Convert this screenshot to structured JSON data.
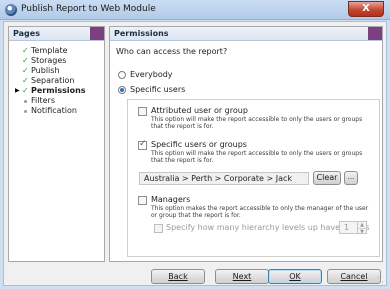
{
  "window": {
    "title": "Publish Report to Web Module",
    "close_label": "X",
    "icon": "publish-icon"
  },
  "pages": {
    "header": "Pages",
    "items": [
      {
        "label": "Template",
        "done": true
      },
      {
        "label": "Storages",
        "done": true
      },
      {
        "label": "Publish",
        "done": true
      },
      {
        "label": "Separation",
        "done": true
      },
      {
        "label": "Permissions",
        "done": true,
        "current": true
      },
      {
        "label": "Filters",
        "done": false
      },
      {
        "label": "Notification",
        "done": false
      }
    ]
  },
  "permissions": {
    "header": "Permissions",
    "question": "Who can access the report?",
    "everybody_label": "Everybody",
    "specific_users_label": "Specific users",
    "selected": "specific_users",
    "attributed": {
      "label": "Attributed user or group",
      "description_1": "This option will make the report accessible to only the users or groups",
      "description_2": "that the report is for.",
      "checked": false
    },
    "specific": {
      "label": "Specific users or groups",
      "description_1": "This option will make the report accessible to only the users or groups",
      "description_2": "that the report is for.",
      "checked": true,
      "path_value": "Australia > Perth > Corporate > Jack",
      "clear_label": "Clear",
      "browse_label": "..."
    },
    "managers": {
      "label": "Managers",
      "description_1": "This option makes the report accessible to only the manager of the user",
      "description_2": "or group that the report is for.",
      "checked": false,
      "levels_label": "Specify how many hierarchy levels up have access",
      "levels_checked": false,
      "levels_value": "1"
    }
  },
  "footer": {
    "back": "Back",
    "next": "Next",
    "ok": "OK",
    "cancel": "Cancel"
  },
  "colors": {
    "accent": "#7b3f82",
    "check_green": "#2f9a2f",
    "title_bar": "#c9dcf2"
  }
}
